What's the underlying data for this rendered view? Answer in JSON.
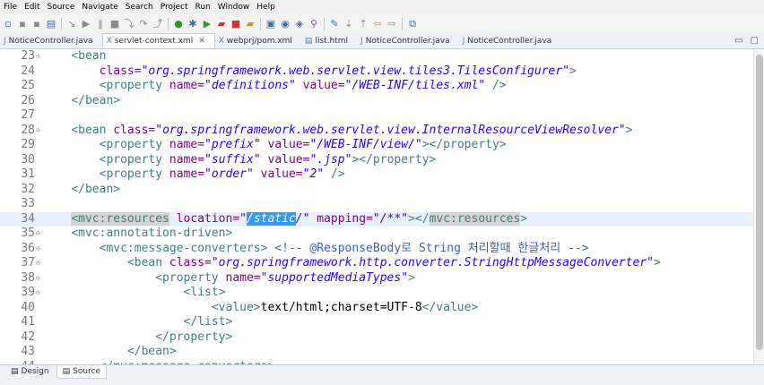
{
  "menu": [
    "File",
    "Edit",
    "Source",
    "Navigate",
    "Search",
    "Project",
    "Run",
    "Window",
    "Help"
  ],
  "tabs": [
    {
      "label": "NoticeController.java",
      "icon": "java-file-icon",
      "active": false
    },
    {
      "label": "servlet-context.xml",
      "icon": "xml-file-icon",
      "active": true
    },
    {
      "label": "webprj/pom.xml",
      "icon": "xml-file-icon",
      "active": false
    },
    {
      "label": "list.html",
      "icon": "html-file-icon",
      "active": false
    },
    {
      "label": "NoticeController.java",
      "icon": "java-file-icon",
      "active": false
    },
    {
      "label": "NoticeController.java",
      "icon": "java-file-icon",
      "active": false
    }
  ],
  "lines": [
    {
      "num": "23",
      "fold": true,
      "indent": "    ",
      "parts": [
        {
          "t": "<bean",
          "c": "tag"
        }
      ]
    },
    {
      "num": "24",
      "fold": false,
      "indent": "        ",
      "parts": [
        {
          "t": "class=",
          "c": "attr"
        },
        {
          "t": "\"org.springframework.web.servlet.view.tiles3.TilesConfigurer\"",
          "c": "val"
        },
        {
          "t": ">",
          "c": "tag"
        }
      ]
    },
    {
      "num": "25",
      "fold": false,
      "indent": "        ",
      "parts": [
        {
          "t": "<property ",
          "c": "tag"
        },
        {
          "t": "name=",
          "c": "attr"
        },
        {
          "t": "\"definitions\"",
          "c": "val"
        },
        {
          "t": " value=",
          "c": "attr"
        },
        {
          "t": "\"/WEB-INF/tiles.xml\"",
          "c": "val"
        },
        {
          "t": " />",
          "c": "tag"
        }
      ]
    },
    {
      "num": "26",
      "fold": false,
      "indent": "    ",
      "parts": [
        {
          "t": "</bean>",
          "c": "tag"
        }
      ]
    },
    {
      "num": "27",
      "fold": false,
      "indent": "",
      "parts": []
    },
    {
      "num": "28",
      "fold": true,
      "indent": "    ",
      "parts": [
        {
          "t": "<bean ",
          "c": "tag"
        },
        {
          "t": "class=",
          "c": "attr"
        },
        {
          "t": "\"org.springframework.web.servlet.view.InternalResourceViewResolver\"",
          "c": "val"
        },
        {
          "t": ">",
          "c": "tag"
        }
      ]
    },
    {
      "num": "29",
      "fold": false,
      "indent": "        ",
      "parts": [
        {
          "t": "<property ",
          "c": "tag"
        },
        {
          "t": "name=",
          "c": "attr"
        },
        {
          "t": "\"prefix\"",
          "c": "val"
        },
        {
          "t": " value=",
          "c": "attr"
        },
        {
          "t": "\"/WEB-INF/view/\"",
          "c": "val"
        },
        {
          "t": "></property>",
          "c": "tag"
        }
      ]
    },
    {
      "num": "30",
      "fold": false,
      "indent": "        ",
      "parts": [
        {
          "t": "<property ",
          "c": "tag"
        },
        {
          "t": "name=",
          "c": "attr"
        },
        {
          "t": "\"suffix\"",
          "c": "val"
        },
        {
          "t": " value=",
          "c": "attr"
        },
        {
          "t": "\".jsp\"",
          "c": "val"
        },
        {
          "t": "></property>",
          "c": "tag"
        }
      ]
    },
    {
      "num": "31",
      "fold": false,
      "indent": "        ",
      "parts": [
        {
          "t": "<property ",
          "c": "tag"
        },
        {
          "t": "name=",
          "c": "attr"
        },
        {
          "t": "\"order\"",
          "c": "val"
        },
        {
          "t": " value=",
          "c": "attr"
        },
        {
          "t": "\"2\"",
          "c": "val"
        },
        {
          "t": " />",
          "c": "tag"
        }
      ]
    },
    {
      "num": "32",
      "fold": false,
      "indent": "    ",
      "parts": [
        {
          "t": "</bean>",
          "c": "tag"
        }
      ]
    },
    {
      "num": "33",
      "fold": false,
      "indent": "",
      "parts": []
    },
    {
      "num": "34",
      "fold": false,
      "current": true,
      "indent": "    ",
      "parts": [
        {
          "t": "<mvc:resources",
          "c": "tag hl"
        },
        {
          "t": " location=",
          "c": "attr"
        },
        {
          "t": "\"",
          "c": "val"
        },
        {
          "t": "/static",
          "c": "val sel"
        },
        {
          "t": "/\"",
          "c": "val"
        },
        {
          "t": " mapping=",
          "c": "attr"
        },
        {
          "t": "\"/**\"",
          "c": "val"
        },
        {
          "t": "></",
          "c": "tag"
        },
        {
          "t": "mvc:resources",
          "c": "tag hl"
        },
        {
          "t": ">",
          "c": "tag"
        }
      ]
    },
    {
      "num": "35",
      "fold": true,
      "indent": "    ",
      "parts": [
        {
          "t": "<mvc:annotation-driven>",
          "c": "tag"
        }
      ]
    },
    {
      "num": "36",
      "fold": true,
      "indent": "        ",
      "parts": [
        {
          "t": "<mvc:message-converters>",
          "c": "tag"
        },
        {
          "t": " <!-- @ResponseBody로 String 처리할때 한글처리 -->",
          "c": "comment"
        }
      ]
    },
    {
      "num": "37",
      "fold": true,
      "indent": "            ",
      "parts": [
        {
          "t": "<bean ",
          "c": "tag"
        },
        {
          "t": "class=",
          "c": "attr"
        },
        {
          "t": "\"org.springframework.http.converter.StringHttpMessageConverter\"",
          "c": "val"
        },
        {
          "t": ">",
          "c": "tag"
        }
      ]
    },
    {
      "num": "38",
      "fold": true,
      "indent": "                ",
      "parts": [
        {
          "t": "<property ",
          "c": "tag"
        },
        {
          "t": "name=",
          "c": "attr"
        },
        {
          "t": "\"supportedMediaTypes\"",
          "c": "val"
        },
        {
          "t": ">",
          "c": "tag"
        }
      ]
    },
    {
      "num": "39",
      "fold": true,
      "indent": "                    ",
      "parts": [
        {
          "t": "<list>",
          "c": "tag"
        }
      ]
    },
    {
      "num": "40",
      "fold": false,
      "indent": "                        ",
      "parts": [
        {
          "t": "<value>",
          "c": "tag"
        },
        {
          "t": "text/html;charset=UTF-8",
          "c": "plain"
        },
        {
          "t": "</value>",
          "c": "tag"
        }
      ]
    },
    {
      "num": "41",
      "fold": false,
      "indent": "                    ",
      "parts": [
        {
          "t": "</list>",
          "c": "tag"
        }
      ]
    },
    {
      "num": "42",
      "fold": false,
      "indent": "                ",
      "parts": [
        {
          "t": "</property>",
          "c": "tag"
        }
      ]
    },
    {
      "num": "43",
      "fold": false,
      "indent": "            ",
      "parts": [
        {
          "t": "</bean>",
          "c": "tag"
        }
      ]
    },
    {
      "num": "44",
      "fold": false,
      "indent": "        ",
      "parts": [
        {
          "t": "</mvc:message-converters>",
          "c": "tag"
        }
      ]
    }
  ],
  "bottom_tabs": [
    {
      "label": "Design",
      "active": false
    },
    {
      "label": "Source",
      "active": true
    }
  ]
}
